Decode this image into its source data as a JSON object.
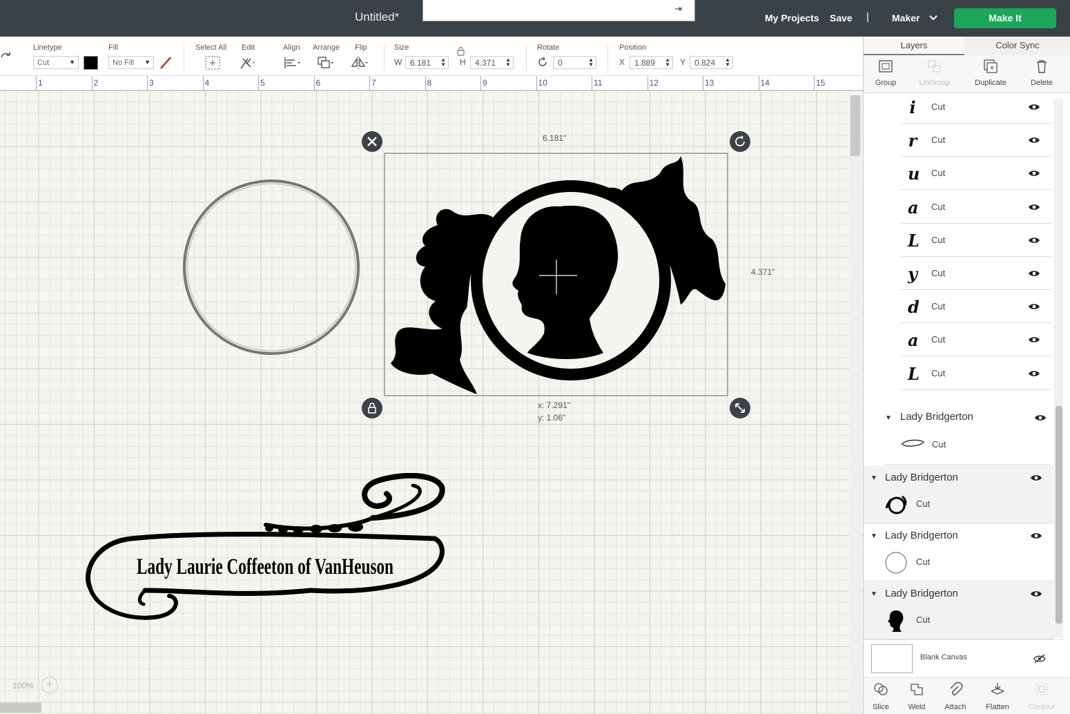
{
  "topbar": {
    "title": "Untitled*",
    "my_projects": "My Projects",
    "save": "Save",
    "separator": "|",
    "machine": "Maker",
    "make_it": "Make It"
  },
  "toolbar": {
    "linetype_label": "Linetype",
    "linetype_value": "Cut",
    "fill_label": "Fill",
    "fill_value": "No Fill",
    "select_all_label": "Select All",
    "edit_label": "Edit",
    "align_label": "Align",
    "arrange_label": "Arrange",
    "flip_label": "Flip",
    "size_label": "Size",
    "w_label": "W",
    "w_value": "6.181",
    "h_label": "H",
    "h_value": "4.371",
    "rotate_label": "Rotate",
    "rotate_value": "0",
    "position_label": "Position",
    "x_label": "X",
    "x_value": "1.889",
    "y_label": "Y",
    "y_value": "0.824",
    "color_swatch": "#000000",
    "accent_green": "#1ca65a"
  },
  "ruler": [
    "1",
    "2",
    "3",
    "4",
    "5",
    "6",
    "7",
    "8",
    "9",
    "10",
    "11",
    "12",
    "13",
    "14",
    "15"
  ],
  "canvas": {
    "width_readout": "6.181\"",
    "height_readout": "4.371\"",
    "pos_x_readout": "x: 7.291\"",
    "pos_y_readout": "y: 1.06\"",
    "banner_text": "Lady Laurie Coffeeton of VanHeuson",
    "zoom": "100%"
  },
  "panel": {
    "tab_layers": "Layers",
    "tab_color_sync": "Color Sync",
    "group": "Group",
    "ungroup": "UnGroup",
    "duplicate": "Duplicate",
    "delete": "Delete",
    "letter_layers": [
      {
        "glyph": "i",
        "op": "Cut"
      },
      {
        "glyph": "r",
        "op": "Cut"
      },
      {
        "glyph": "u",
        "op": "Cut"
      },
      {
        "glyph": "a",
        "op": "Cut"
      },
      {
        "glyph": "L",
        "op": "Cut"
      },
      {
        "glyph": "y",
        "op": "Cut"
      },
      {
        "glyph": "d",
        "op": "Cut"
      },
      {
        "glyph": "a",
        "op": "Cut"
      },
      {
        "glyph": "L",
        "op": "Cut"
      }
    ],
    "sub_group_name": "Lady Bridgerton",
    "sub_group_op": "Cut",
    "groups": [
      {
        "name": "Lady Bridgerton",
        "op": "Cut",
        "thumb": "cameo-frame"
      },
      {
        "name": "Lady Bridgerton",
        "op": "Cut",
        "thumb": "circle"
      },
      {
        "name": "Lady Bridgerton",
        "op": "Cut",
        "thumb": "silhouette"
      }
    ],
    "blank_canvas": "Blank Canvas",
    "slice": "Slice",
    "weld": "Weld",
    "attach": "Attach",
    "flatten": "Flatten",
    "contour": "Contour"
  }
}
